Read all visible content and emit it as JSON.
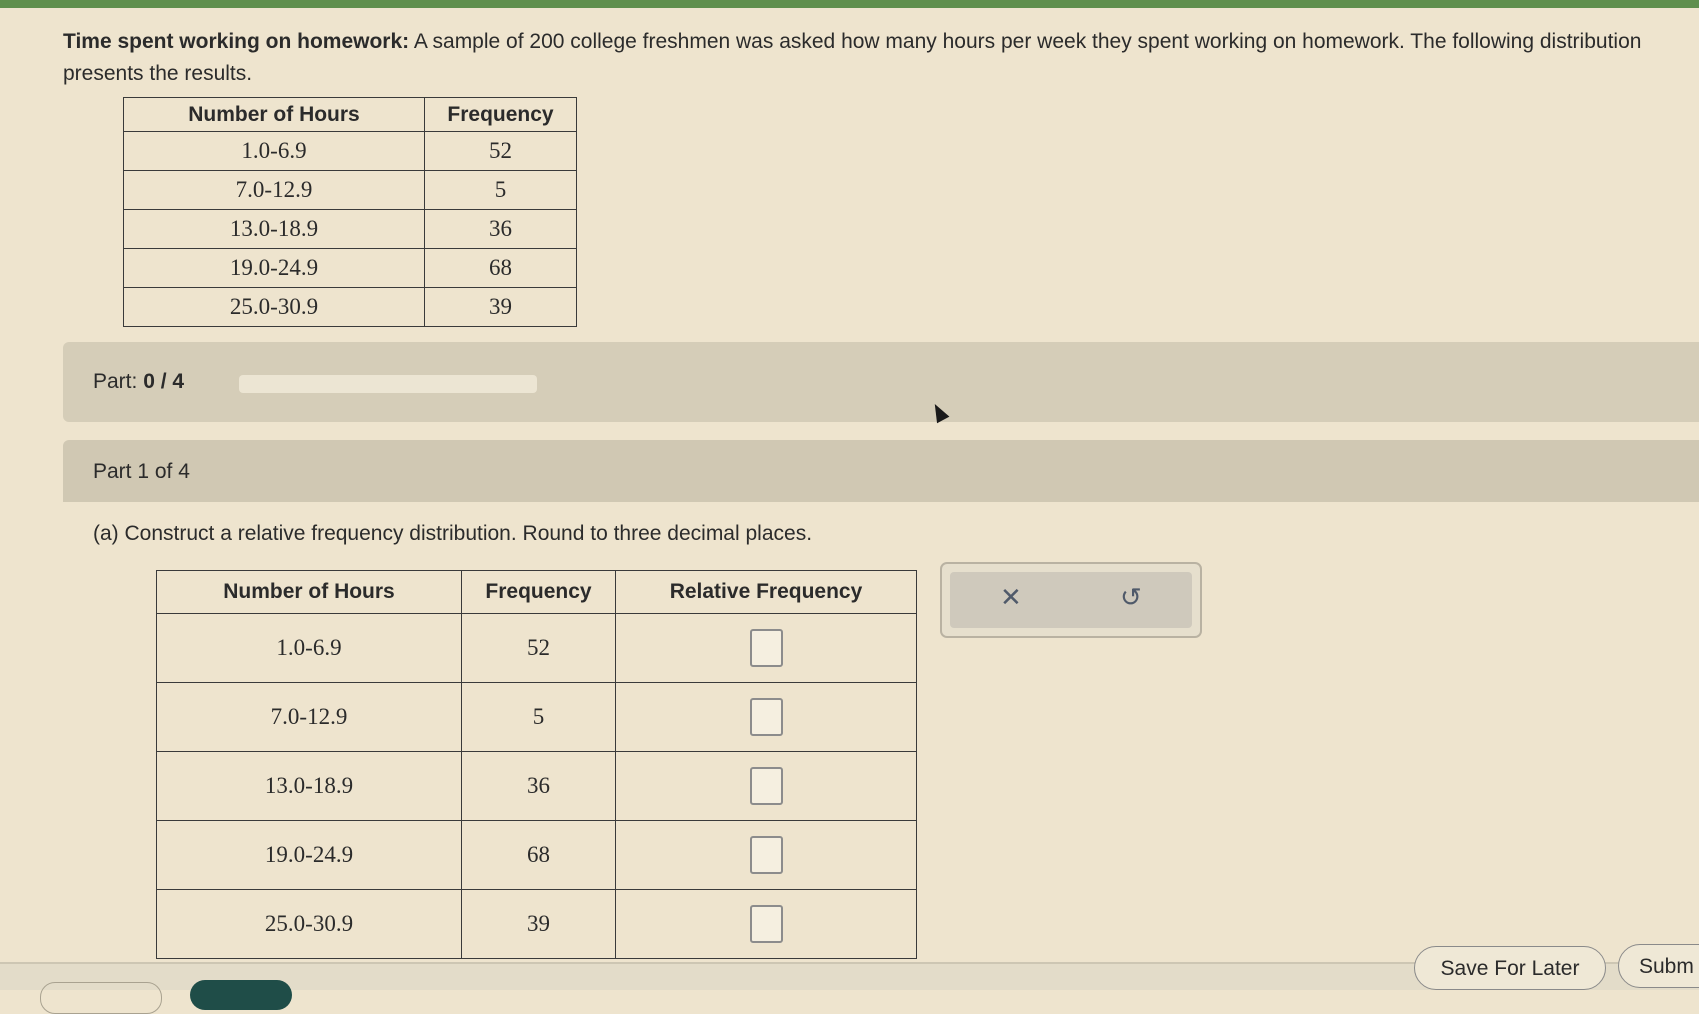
{
  "intro": {
    "title": "Time spent working on homework:",
    "text": " A sample of 200 college freshmen was asked how many hours per week they spent working on homework. The following distribution presents the results."
  },
  "given_table": {
    "headers": [
      "Number of Hours",
      "Frequency"
    ],
    "rows": [
      [
        "1.0-6.9",
        "52"
      ],
      [
        "7.0-12.9",
        "5"
      ],
      [
        "13.0-18.9",
        "36"
      ],
      [
        "19.0-24.9",
        "68"
      ],
      [
        "25.0-30.9",
        "39"
      ]
    ]
  },
  "progress": {
    "label": "Part:",
    "value": "0 / 4",
    "fraction": 0
  },
  "part1": {
    "label": "Part 1 of 4",
    "instruction": "(a) Construct a relative frequency distribution. Round to three decimal places."
  },
  "answer_table": {
    "headers": [
      "Number of Hours",
      "Frequency",
      "Relative Frequency"
    ],
    "rows": [
      [
        "1.0-6.9",
        "52",
        ""
      ],
      [
        "7.0-12.9",
        "5",
        ""
      ],
      [
        "13.0-18.9",
        "36",
        ""
      ],
      [
        "19.0-24.9",
        "68",
        ""
      ],
      [
        "25.0-30.9",
        "39",
        ""
      ]
    ]
  },
  "tools": {
    "clear_glyph": "✕",
    "undo_glyph": "↺",
    "clear_icon": "close-icon",
    "undo_icon": "undo-icon"
  },
  "footer": {
    "save_label": "Save For Later",
    "submit_label": "Subm"
  },
  "colors": {
    "accent": "#5f8f4d",
    "background": "#eee4ce",
    "primary_button": "#1f4d48"
  }
}
